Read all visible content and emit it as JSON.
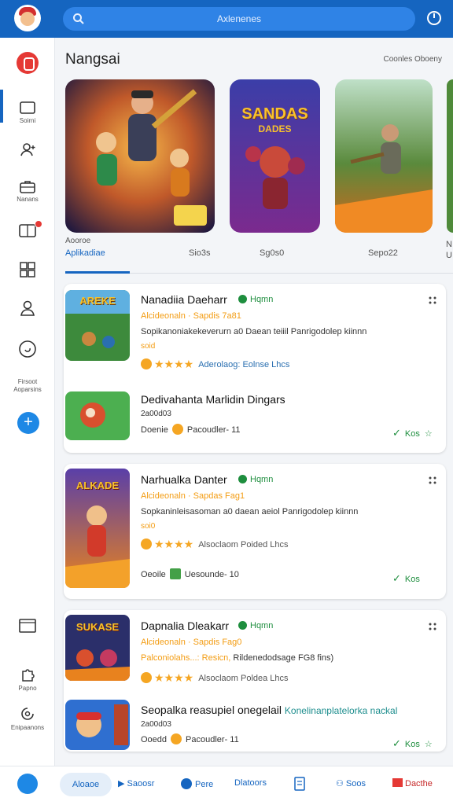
{
  "header": {
    "search_placeholder": "Axlenenes"
  },
  "sidebar": {
    "items": [
      {
        "label": "Soirni",
        "icon": "tablet-icon"
      },
      {
        "label": "",
        "icon": "user-plus-icon"
      },
      {
        "label": "Nanans",
        "icon": "briefcase-icon"
      },
      {
        "label": "",
        "icon": "gift-icon"
      },
      {
        "label": "",
        "icon": "grid-icon"
      },
      {
        "label": "",
        "icon": "person-icon"
      },
      {
        "label": "",
        "icon": "circle-icon"
      },
      {
        "label": "Firsoot Aoparsins",
        "icon": ""
      }
    ],
    "bottom_items": [
      {
        "label": "",
        "icon": "window-icon"
      },
      {
        "label": "Papno",
        "icon": "puzzle-icon"
      },
      {
        "label": "Enipaanons",
        "icon": "settings-icon"
      }
    ]
  },
  "featured": {
    "title": "Nangsai",
    "see_all": "Coonles Oboeny",
    "banners": [
      {
        "title": "",
        "caption_top": "Aooroe",
        "caption": "Aplikadiae"
      },
      {
        "title": "SANDAS",
        "subtitle": "DADES",
        "caption": "Sio3s"
      },
      {
        "title": "",
        "caption": "Sg0s0"
      },
      {
        "title": "",
        "caption": "Sepo22"
      }
    ],
    "edge_caption": "N U"
  },
  "apps": [
    {
      "title": "Nanadiia Daeharr",
      "verified": "Hqmn",
      "subtitle": "Alcideonaln · Sapdis 7a81",
      "desc": "Sopikanoniakekeverurn a0 Daean teiiil Panrigodolep kiinnn",
      "extra": "soid",
      "rating_text": "Aderolaog: Eolnse Lhcs",
      "thumb_text": "AREKE"
    },
    {
      "title": "Dedivahanta Marlidin Dingars",
      "count": "2a00d03",
      "meta_left": "Doenie",
      "meta_right": "Pacoudler- 11",
      "action": "Kos"
    },
    {
      "title": "Narhualka Danter",
      "verified": "Hqmn",
      "subtitle": "Alcideonaln · Sapdas Fag1",
      "desc": "Sopkaninleisasoman a0 daean aeiol Panrigodolep kiinnn",
      "extra": "soi0",
      "rating_text": "Alsoclaom Poided Lhcs",
      "meta_left": "Oeoile",
      "meta_right": "Uesounde- 10",
      "action": "Kos",
      "thumb_text": "ALKADE"
    },
    {
      "title": "Dapnalia Dleakarr",
      "verified": "Hqmn",
      "subtitle": "Alcideonaln · Sapdis Fag0",
      "desc_a": "Palconiolahs...: Resicn,",
      "desc_b": "Rildenedodsage FG8 fins)",
      "rating_text": "Alsoclaom Poldea Lhcs",
      "thumb_text": "SUKASE"
    },
    {
      "title": "Seopalka reasupiel onegelail",
      "highlight": "Konelinanplatelorka nackal",
      "count": "2a00d03",
      "meta_left": "Ooedd",
      "meta_right": "Pacoudler- 11",
      "action": "Kos"
    }
  ],
  "bottom_nav": {
    "home": "Aloaoe",
    "items": [
      "Saoosr",
      "Pere",
      "Dlatoors",
      "",
      "Soos",
      "Dacthe"
    ]
  },
  "colors": {
    "primary": "#1565c0",
    "accent_orange": "#f5a623",
    "verified_green": "#1e8e3e",
    "danger_red": "#e53935"
  }
}
